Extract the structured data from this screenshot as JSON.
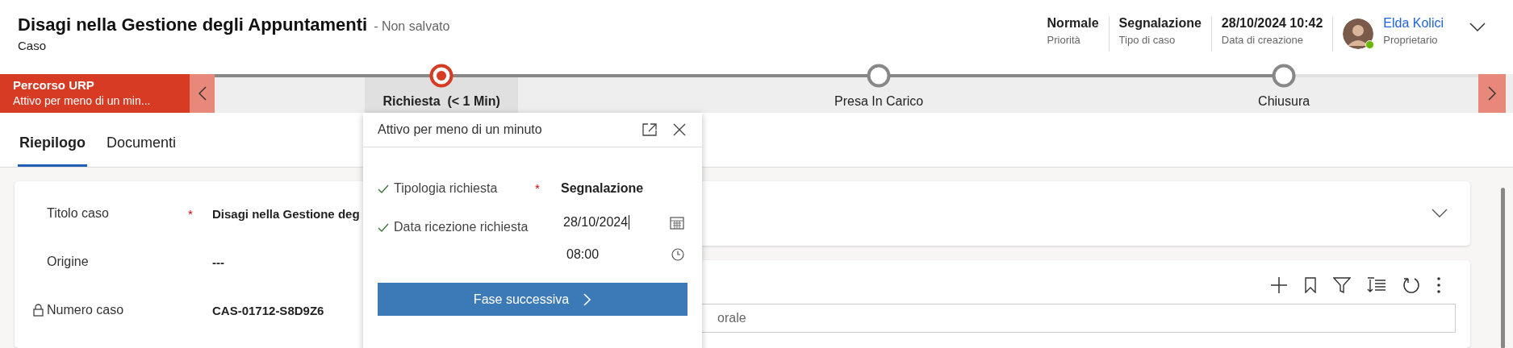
{
  "header": {
    "title": "Disagi nella Gestione degli Appuntamenti",
    "save_status": "- Non salvato",
    "entity": "Caso",
    "fields": [
      {
        "value": "Normale",
        "label": "Priorità"
      },
      {
        "value": "Segnalazione",
        "label": "Tipo di caso"
      },
      {
        "value": "28/10/2024 10:42",
        "label": "Data di creazione"
      }
    ],
    "owner": {
      "name": "Elda Kolici",
      "label": "Proprietario",
      "online": true
    }
  },
  "process": {
    "name": "Percorso URP",
    "status": "Attivo per meno di un min...",
    "stages": [
      {
        "label": "Richiesta",
        "duration": "(< 1 Min)",
        "selected": true
      },
      {
        "label": "Presa In Carico",
        "selected": false
      },
      {
        "label": "Chiusura",
        "selected": false
      }
    ]
  },
  "tabs": [
    {
      "label": "Riepilogo",
      "selected": true
    },
    {
      "label": "Documenti",
      "selected": false
    }
  ],
  "form": [
    {
      "label": "Titolo caso",
      "required_mark": "*",
      "locked": false,
      "value": "Disagi nella Gestione deg"
    },
    {
      "label": "Origine",
      "locked": false,
      "value": "---"
    },
    {
      "label": "Numero caso",
      "locked": true,
      "value": "CAS-01712-S8D9Z6"
    }
  ],
  "stage_flyout": {
    "title": "Attivo per meno di un minuto",
    "fields": [
      {
        "kind": "text",
        "label": "Tipologia richiesta",
        "required_mark": "*",
        "completed": true,
        "value": "Segnalazione"
      },
      {
        "kind": "datetime",
        "label": "Data ricezione richiesta",
        "completed": true,
        "value": "28/10/2024",
        "time": "08:00"
      }
    ],
    "button": "Fase successiva"
  },
  "timeline": {
    "search_placeholder": "orale"
  }
}
